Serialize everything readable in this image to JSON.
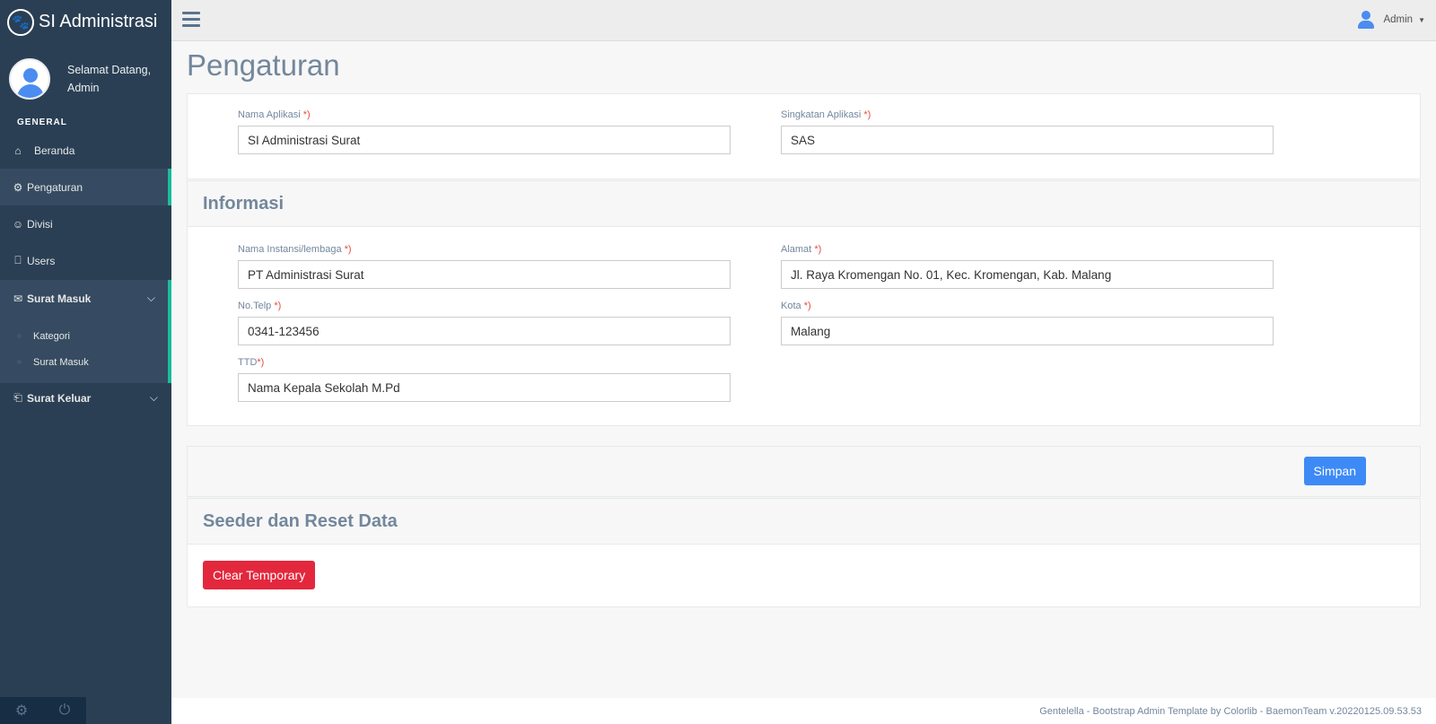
{
  "brand": {
    "title": "SI Administrasi",
    "icon": "paw-icon"
  },
  "profile": {
    "greeting": "Selamat Datang,",
    "name": "Admin"
  },
  "sidebar": {
    "section": "GENERAL",
    "items": [
      {
        "label": "Beranda",
        "icon": "home-icon"
      },
      {
        "label": "Pengaturan",
        "icon": "gears-icon"
      },
      {
        "label": "Divisi",
        "icon": "users-icon"
      },
      {
        "label": "Users",
        "icon": "user-lock-icon"
      },
      {
        "label": "Surat Masuk",
        "icon": "envelope-icon"
      },
      {
        "label": "Surat Keluar",
        "icon": "inbox-icon"
      }
    ],
    "submenu": [
      "Kategori",
      "Surat Masuk"
    ]
  },
  "topnav": {
    "user": "Admin"
  },
  "page": {
    "title": "Pengaturan"
  },
  "app_settings": {
    "nama_label": "Nama Aplikasi",
    "nama_value": "SI Administrasi Surat",
    "singkatan_label": "Singkatan Aplikasi",
    "singkatan_value": "SAS",
    "required_mark": "*)"
  },
  "informasi": {
    "heading": "Informasi",
    "instansi_label": "Nama Instansi/lembaga",
    "instansi_value": "PT Administrasi Surat",
    "alamat_label": "Alamat",
    "alamat_value": "Jl. Raya Kromengan No. 01, Kec. Kromengan, Kab. Malang",
    "telp_label": "No.Telp",
    "telp_value": "0341-123456",
    "kota_label": "Kota",
    "kota_value": "Malang",
    "ttd_label": "TTD",
    "ttd_value": "Nama Kepala Sekolah M.Pd"
  },
  "actions": {
    "save": "Simpan"
  },
  "seeder": {
    "heading": "Seeder dan Reset Data",
    "clear": "Clear Temporary"
  },
  "footer": {
    "text": "Gentelella - Bootstrap Admin Template by Colorlib - BaemonTeam v.20220125.09.53.53"
  },
  "colors": {
    "sidebar": "#2a3f54",
    "accent": "#1abb9c",
    "primary": "#3d8af7",
    "danger": "#e3273d"
  }
}
